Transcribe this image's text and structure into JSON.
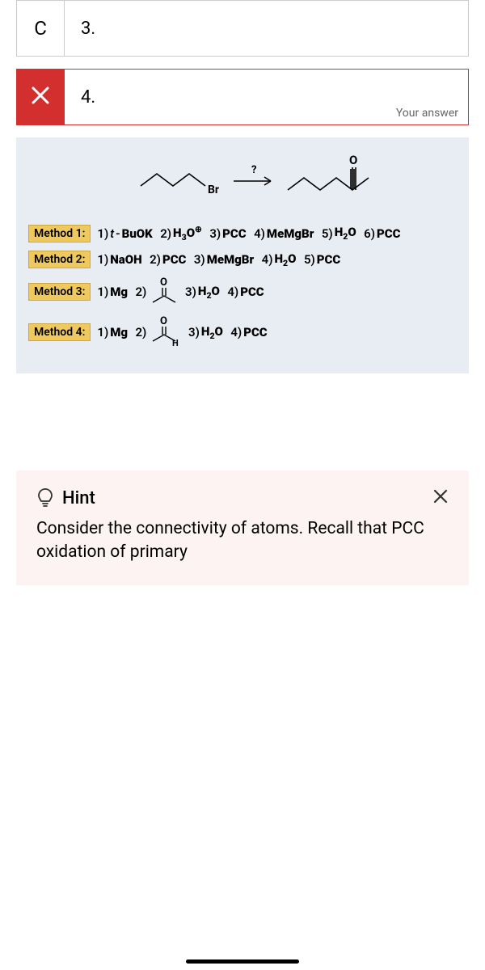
{
  "options": {
    "c": {
      "letter": "C",
      "number": "3."
    },
    "d": {
      "number": "4.",
      "your_answer": "Your answer"
    }
  },
  "solution": {
    "reactant_label": "Br",
    "product_label_O": "O",
    "arrow_label": "?",
    "methods": {
      "m1": {
        "label": "Method 1:",
        "text": "1) t-BuOK  2) H₃O⁺  3) PCC  4) MeMgBr  5) H₂O  6) PCC"
      },
      "m2": {
        "label": "Method 2:",
        "text": "1) NaOH  2) PCC  3) MeMgBr  4) H₂O  5) PCC"
      },
      "m3": {
        "label": "Method 3:",
        "pre": "1) Mg  2)",
        "post": "3) H₂O  4) PCC"
      },
      "m4": {
        "label": "Method 4:",
        "pre": "1) Mg  2)",
        "post": "3) H₂O  4) PCC",
        "sub_h": "H"
      }
    }
  },
  "hint": {
    "title": "Hint",
    "body": "Consider the connectivity of atoms. Recall that PCC oxidation of primary"
  }
}
